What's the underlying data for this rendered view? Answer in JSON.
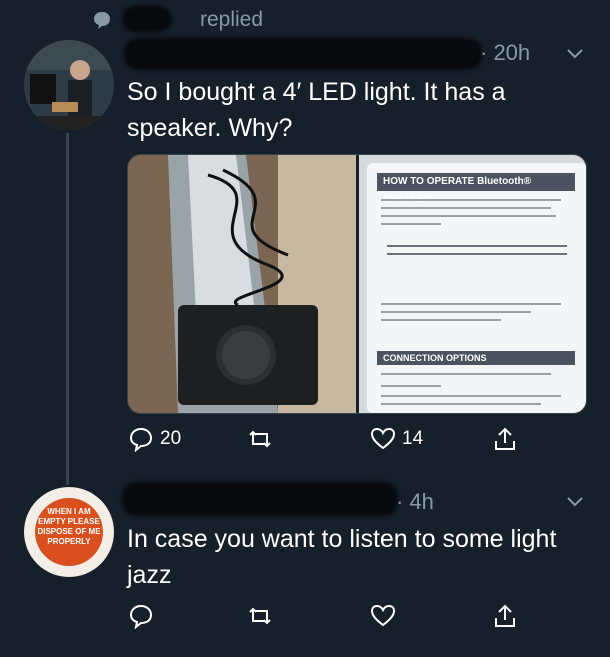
{
  "header": {
    "context_text": "replied"
  },
  "tweets": [
    {
      "timestamp": "· 20h",
      "text": "So I bought a 4′ LED light. It has a speaker. Why?",
      "media": {
        "manual_title": "HOW TO OPERATE Bluetooth® SPEAKER:",
        "manual_section": "CONNECTION OPTIONS"
      },
      "actions": {
        "replies": "20",
        "retweets": "",
        "likes": "14"
      }
    },
    {
      "timestamp": "· 4h",
      "text": "In case you want to listen to some light jazz",
      "avatar_text": "WHEN I AM EMPTY PLEASE DISPOSE OF ME PROPERLY",
      "actions": {
        "replies": "",
        "retweets": "",
        "likes": ""
      }
    }
  ],
  "colors": {
    "background": "#15202b",
    "muted": "#8899a6",
    "divider": "#38444d",
    "avatar_badge": "#d9501e"
  },
  "icons": [
    "speech-bubble-icon",
    "reply-icon",
    "retweet-icon",
    "like-icon",
    "share-icon",
    "chevron-down-icon"
  ]
}
